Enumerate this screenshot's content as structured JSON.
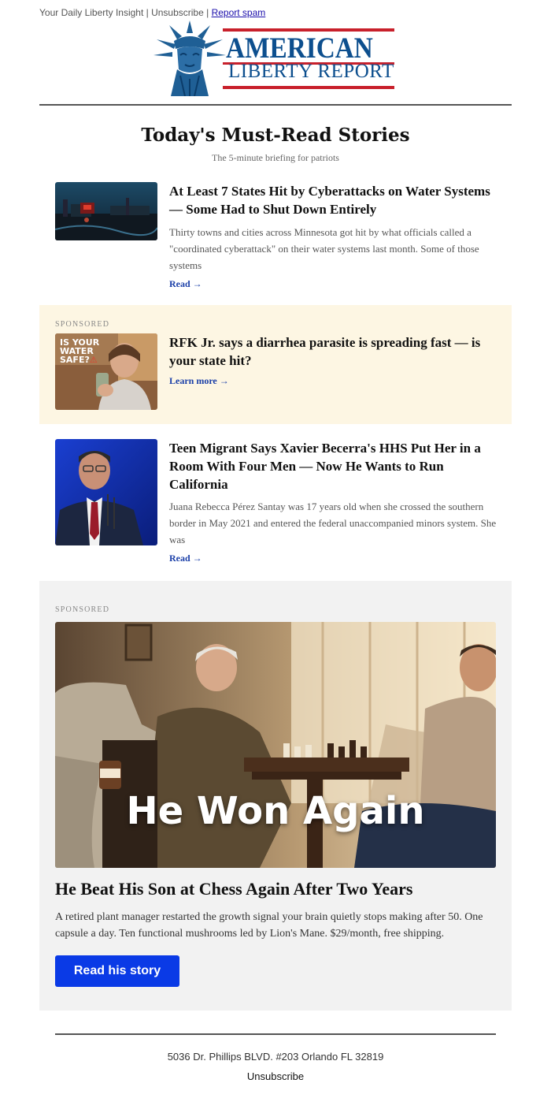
{
  "preheader": {
    "text": "Your Daily Liberty Insight | Unsubscribe | ",
    "report_spam": "Report spam"
  },
  "logo": {
    "line1": "AMERICAN",
    "line2": "LIBERTY REPORT",
    "icon": "statue-of-liberty-icon",
    "colors": {
      "blue": "#0d4f8e",
      "red": "#c8202b"
    }
  },
  "headline": "Today's Must-Read Stories",
  "subheadline": "The 5-minute briefing for patriots",
  "stories": [
    {
      "title": "At Least 7 States Hit by Cyberattacks on Water Systems — Some Had to Shut Down Entirely",
      "body": "Thirty towns and cities across Minnesota got hit by what officials called a \"coordinated cyberattack\" on their water systems last month. Some of those systems",
      "link": "Read →"
    },
    {
      "title": "Teen Migrant Says Xavier Becerra's HHS Put Her in a Room With Four Men — Now He Wants to Run California",
      "body": "Juana Rebecca Pérez Santay was 17 years old when she crossed the southern border in May 2021 and entered the federal unaccompanied minors system. She was",
      "link": "Read →"
    }
  ],
  "sponsored1": {
    "tag": "SPONSORED",
    "image_text": [
      "IS YOUR",
      "WATER",
      "SAFE?"
    ],
    "title": "RFK Jr. says a diarrhea parasite is spreading fast — is your state hit?",
    "link": "Learn more →"
  },
  "sponsored2": {
    "tag": "SPONSORED",
    "image_caption": "He Won Again",
    "title": "He Beat His Son at Chess Again After Two Years",
    "body": "A retired plant manager restarted the growth signal your brain quietly stops making after 50. One capsule a day. Ten functional mushrooms led by Lion's Mane. $29/month, free shipping.",
    "cta": "Read his story",
    "cta_color": "#0a3ae6"
  },
  "footer": {
    "address": "5036 Dr. Phillips BLVD. #203 Orlando FL 32819",
    "unsubscribe": "Unsubscribe"
  }
}
